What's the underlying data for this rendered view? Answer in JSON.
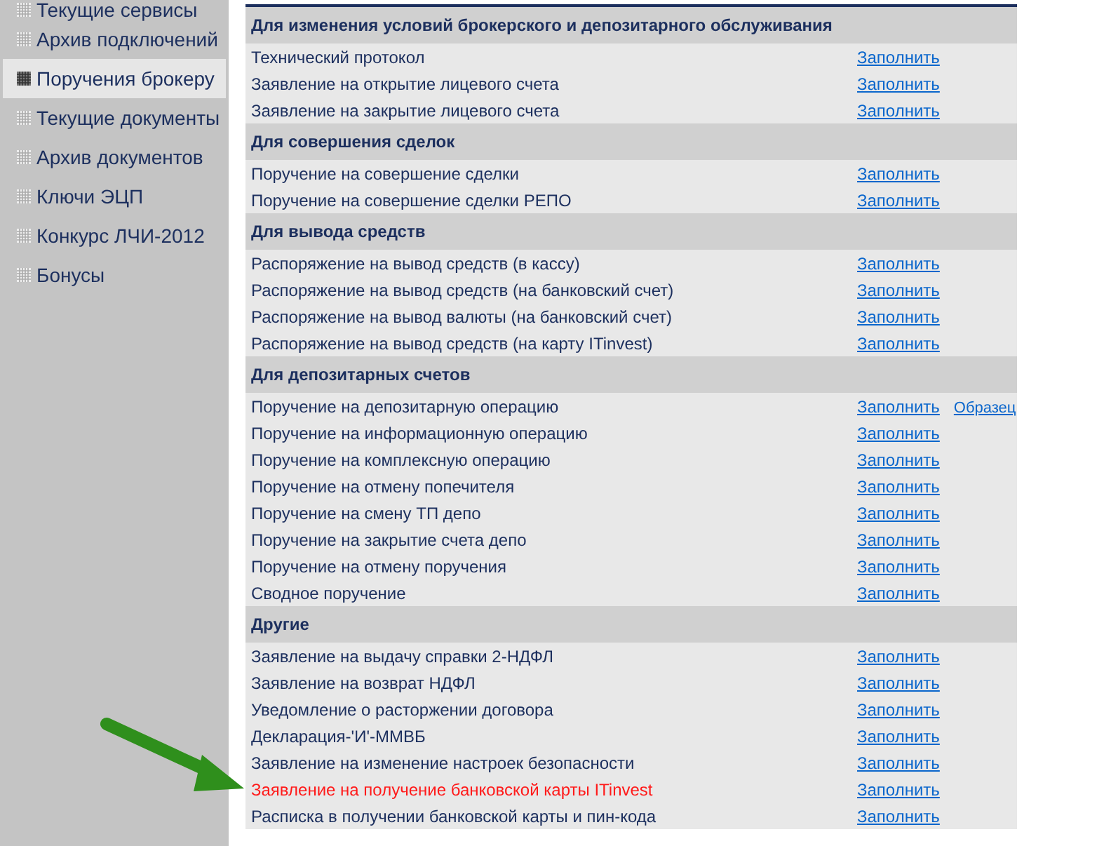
{
  "sidebar": {
    "items": [
      {
        "label": "Текущие сервисы",
        "selected": false
      },
      {
        "label": "Архив подключений",
        "selected": false
      },
      {
        "label": "Поручения брокеру",
        "selected": true
      },
      {
        "label": "Текущие документы",
        "selected": false
      },
      {
        "label": "Архив документов",
        "selected": false
      },
      {
        "label": "Ключи ЭЦП",
        "selected": false
      },
      {
        "label": "Конкурс ЛЧИ-2012",
        "selected": false
      },
      {
        "label": "Бонусы",
        "selected": false
      }
    ]
  },
  "sections": [
    {
      "title": "Для изменения условий брокерского и депозитарного обслуживания",
      "rows": [
        {
          "label": "Технический протокол",
          "highlighted": false,
          "links": [
            "Заполнить"
          ]
        },
        {
          "label": "Заявление на открытие лицевого счета",
          "highlighted": false,
          "links": [
            "Заполнить"
          ]
        },
        {
          "label": "Заявление на закрытие лицевого счета",
          "highlighted": false,
          "links": [
            "Заполнить"
          ]
        }
      ]
    },
    {
      "title": "Для совершения сделок",
      "rows": [
        {
          "label": "Поручение на совершение сделки",
          "highlighted": false,
          "links": [
            "Заполнить"
          ]
        },
        {
          "label": "Поручение на совершение сделки РЕПО",
          "highlighted": false,
          "links": [
            "Заполнить"
          ]
        }
      ]
    },
    {
      "title": "Для вывода средств",
      "rows": [
        {
          "label": "Распоряжение на вывод средств (в кассу)",
          "highlighted": false,
          "links": [
            "Заполнить"
          ]
        },
        {
          "label": "Распоряжение на вывод средств (на банковский счет)",
          "highlighted": false,
          "links": [
            "Заполнить"
          ]
        },
        {
          "label": "Распоряжение на вывод валюты (на банковский счет)",
          "highlighted": false,
          "links": [
            "Заполнить"
          ]
        },
        {
          "label": "Распоряжение на вывод средств (на карту ITinvest)",
          "highlighted": false,
          "links": [
            "Заполнить"
          ]
        }
      ]
    },
    {
      "title": "Для депозитарных счетов",
      "rows": [
        {
          "label": "Поручение на депозитарную операцию",
          "highlighted": false,
          "links": [
            "Заполнить",
            "Образец"
          ]
        },
        {
          "label": "Поручение на информационную операцию",
          "highlighted": false,
          "links": [
            "Заполнить"
          ]
        },
        {
          "label": "Поручение на комплексную операцию",
          "highlighted": false,
          "links": [
            "Заполнить"
          ]
        },
        {
          "label": "Поручение на отмену попечителя",
          "highlighted": false,
          "links": [
            "Заполнить"
          ]
        },
        {
          "label": "Поручение на смену ТП депо",
          "highlighted": false,
          "links": [
            "Заполнить"
          ]
        },
        {
          "label": "Поручение на закрытие счета депо",
          "highlighted": false,
          "links": [
            "Заполнить"
          ]
        },
        {
          "label": "Поручение на отмену поручения",
          "highlighted": false,
          "links": [
            "Заполнить"
          ]
        },
        {
          "label": "Сводное поручение",
          "highlighted": false,
          "links": [
            "Заполнить"
          ]
        }
      ]
    },
    {
      "title": "Другие",
      "rows": [
        {
          "label": "Заявление на выдачу справки 2-НДФЛ",
          "highlighted": false,
          "links": [
            "Заполнить"
          ]
        },
        {
          "label": "Заявление на возврат НДФЛ",
          "highlighted": false,
          "links": [
            "Заполнить"
          ]
        },
        {
          "label": "Уведомление о расторжении договора",
          "highlighted": false,
          "links": [
            "Заполнить"
          ]
        },
        {
          "label": "Декларация-'И'-ММВБ",
          "highlighted": false,
          "links": [
            "Заполнить"
          ]
        },
        {
          "label": "Заявление на изменение настроек безопасности",
          "highlighted": false,
          "links": [
            "Заполнить"
          ]
        },
        {
          "label": "Заявление на получение банковской карты ITinvest",
          "highlighted": true,
          "links": [
            "Заполнить"
          ]
        },
        {
          "label": "Расписка в получении банковской карты и пин-кода",
          "highlighted": false,
          "links": [
            "Заполнить"
          ]
        }
      ]
    }
  ]
}
